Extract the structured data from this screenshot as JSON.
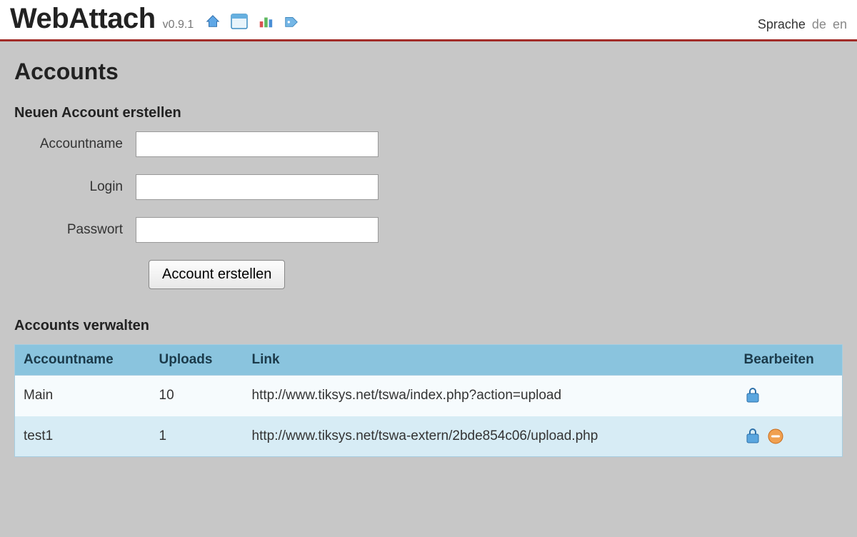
{
  "header": {
    "logo": "WebAttach",
    "version": "v0.9.1",
    "language_label": "Sprache",
    "languages": [
      "de",
      "en"
    ]
  },
  "page": {
    "title": "Accounts",
    "create_section_title": "Neuen Account erstellen",
    "labels": {
      "accountname": "Accountname",
      "login": "Login",
      "password": "Passwort"
    },
    "create_button": "Account erstellen",
    "manage_section_title": "Accounts verwalten"
  },
  "table": {
    "headers": {
      "accountname": "Accountname",
      "uploads": "Uploads",
      "link": "Link",
      "edit": "Bearbeiten"
    },
    "rows": [
      {
        "name": "Main",
        "uploads": "10",
        "link": "http://www.tiksys.net/tswa/index.php?action=upload",
        "deletable": false
      },
      {
        "name": "test1",
        "uploads": "1",
        "link": "http://www.tiksys.net/tswa-extern/2bde854c06/upload.php",
        "deletable": true
      }
    ]
  }
}
